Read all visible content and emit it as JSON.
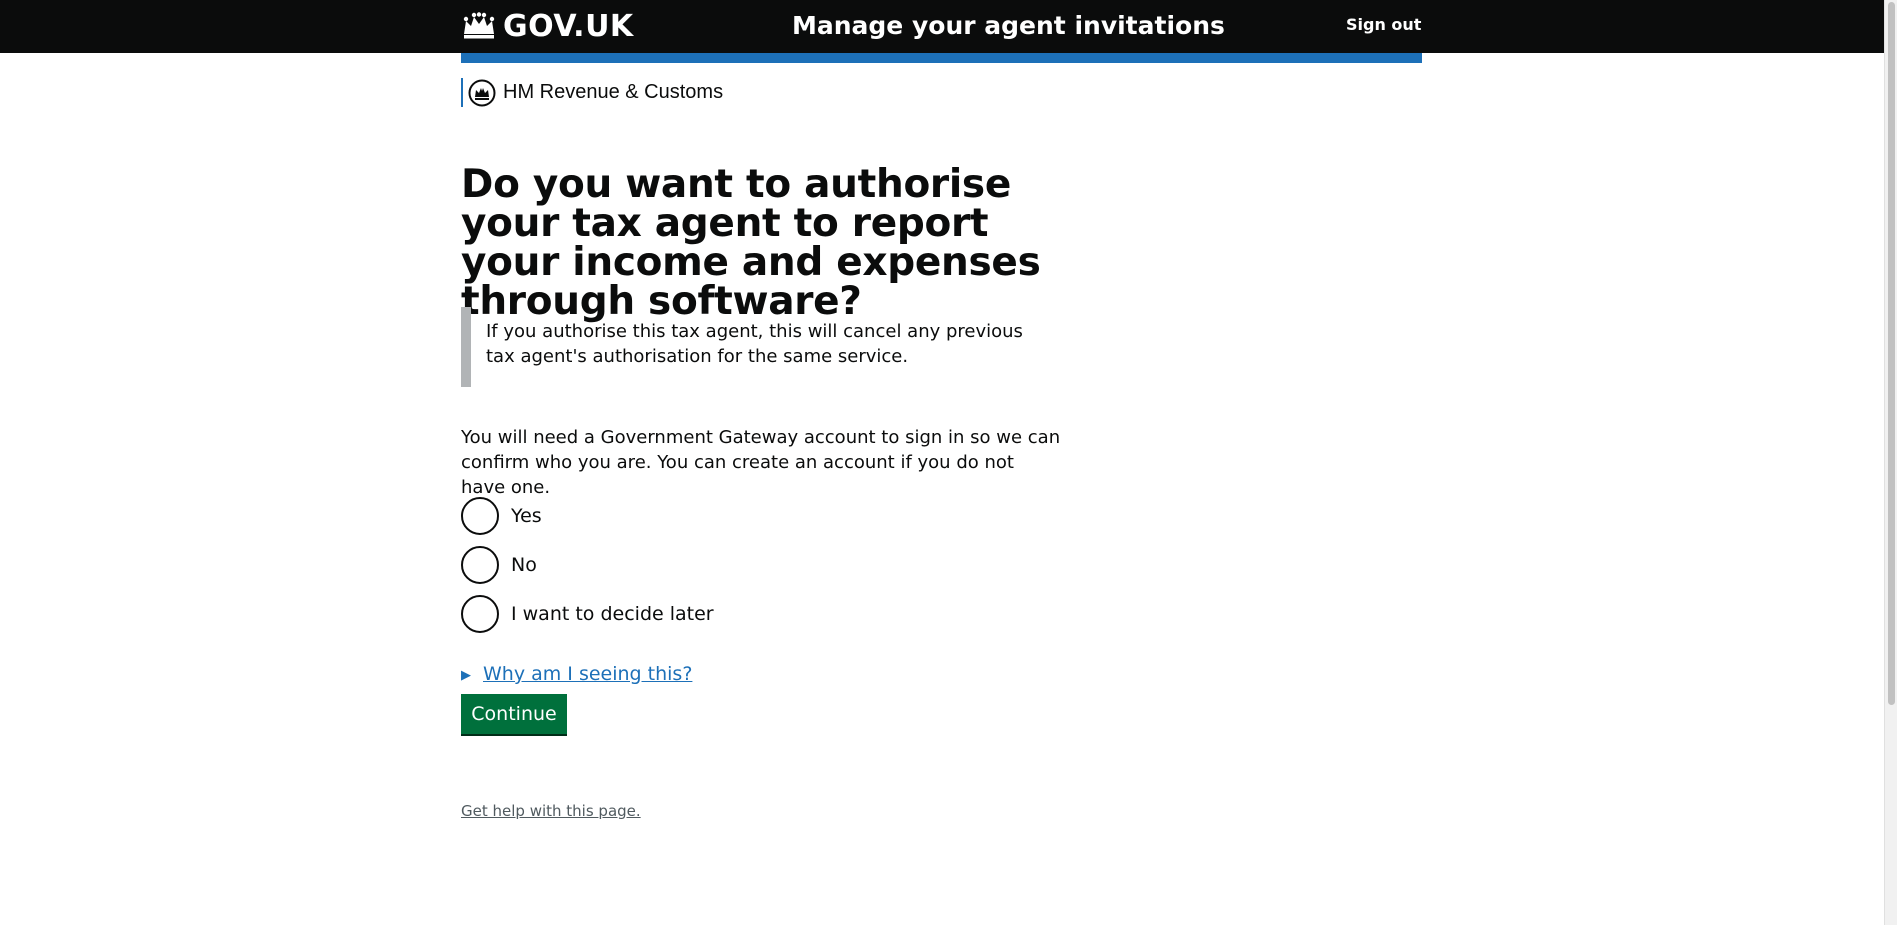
{
  "header": {
    "logo_text": "GOV.UK",
    "service_name": "Manage your agent invitations",
    "sign_out": "Sign out"
  },
  "organisation": "HM Revenue & Customs",
  "page": {
    "heading": "Do you want to authorise your tax agent to report your income and expenses through software?",
    "inset_text": "If you authorise this tax agent, this will cancel any previous tax agent's authorisation for the same service.",
    "body_text": "You will need a Government Gateway account to sign in so we can confirm who you are. You can create an account if you do not have one."
  },
  "radios": [
    {
      "label": "Yes"
    },
    {
      "label": "No"
    },
    {
      "label": "I want to decide later"
    }
  ],
  "details_summary": "Why am I seeing this?",
  "continue_label": "Continue",
  "help_link": "Get help with this page.",
  "colors": {
    "header_bg": "#0b0c0c",
    "brand_blue": "#1d70b8",
    "button_green": "#00703c",
    "inset_border": "#b1b4b6"
  }
}
